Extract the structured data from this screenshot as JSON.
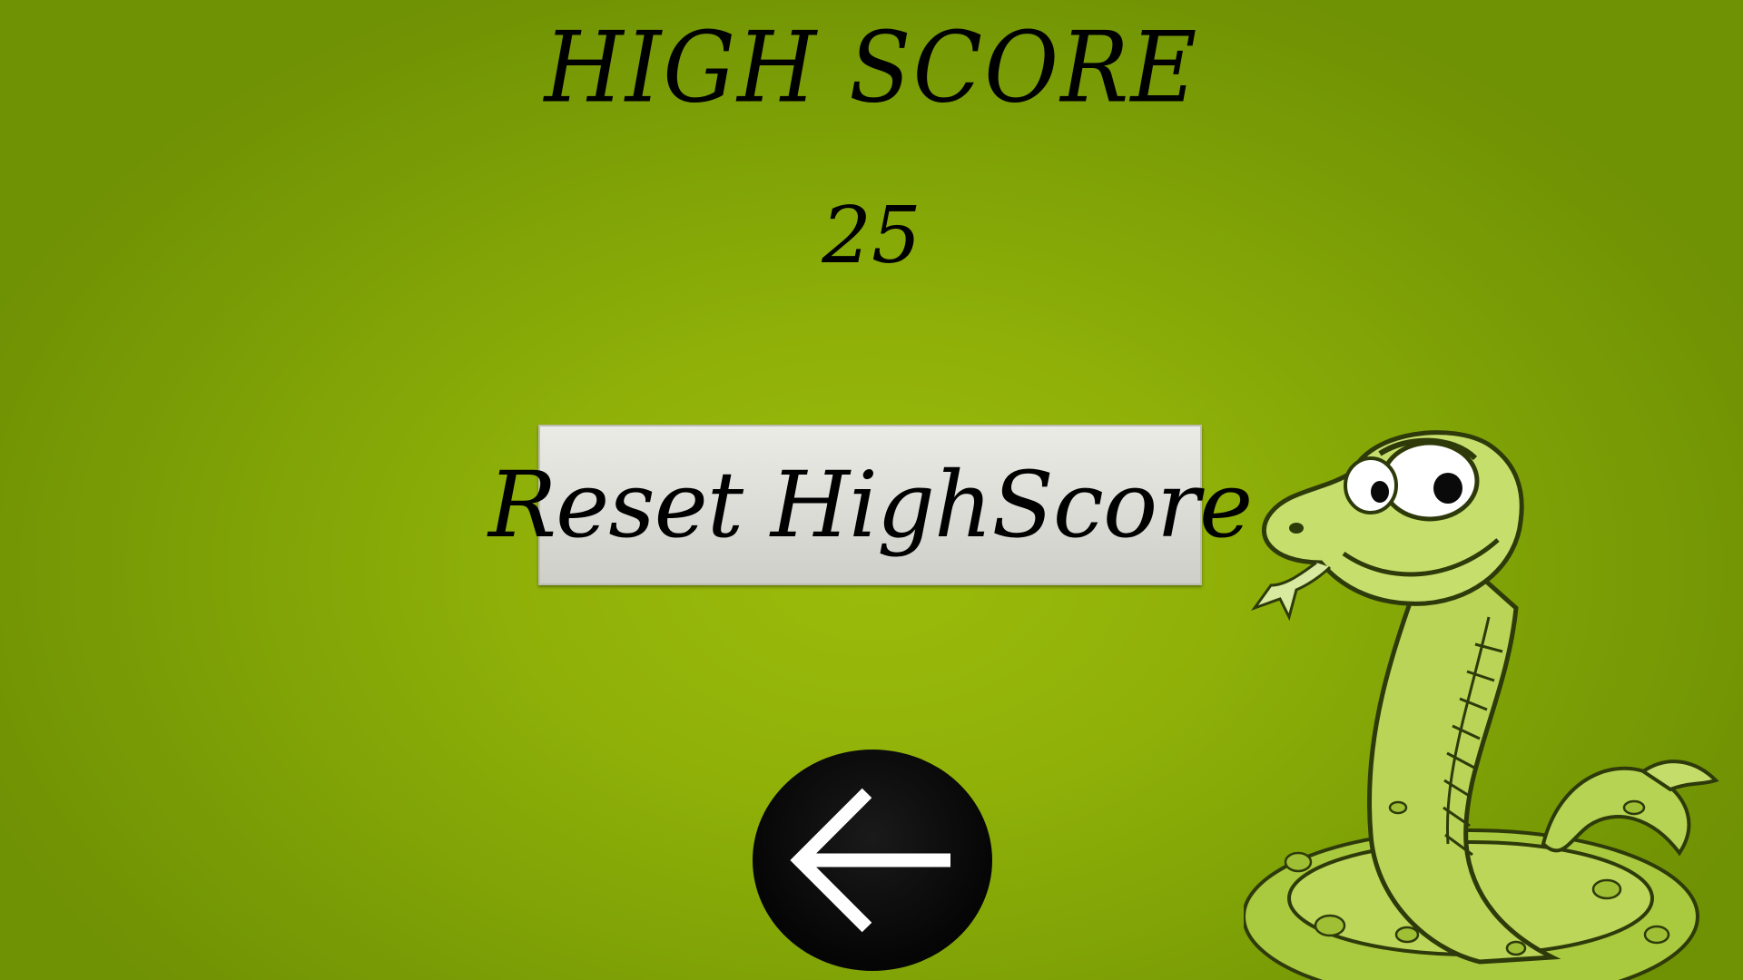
{
  "screen": {
    "title": "HIGH SCORE",
    "score": "25"
  },
  "buttons": {
    "reset_label": "Reset HighScore",
    "back_icon": "arrow-left-icon"
  },
  "decoration": {
    "mascot": "snake-mascot"
  },
  "colors": {
    "background": "#8fb008",
    "text": "#000000",
    "button_face": "#dcdcd7",
    "back_button": "#050505",
    "arrow": "#ffffff"
  }
}
